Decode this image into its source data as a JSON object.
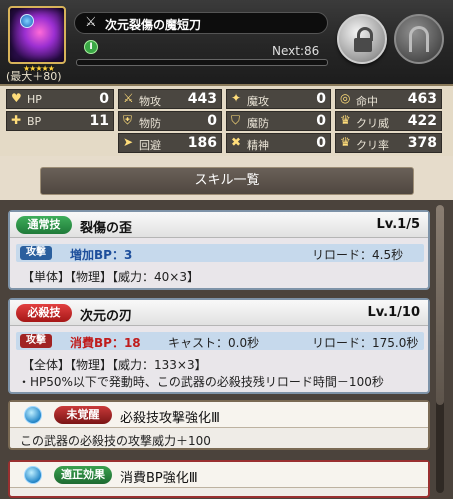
{
  "header": {
    "weapon_name": "次元裂傷の魔短刀",
    "max_label": "(最大＋80)",
    "level_badge": "I",
    "next_label": "Next:86",
    "stars": "★★★★★"
  },
  "stats": [
    {
      "icon": "heart-icon",
      "label": "HP",
      "value": "0"
    },
    {
      "icon": "sword-icon",
      "label": "物攻",
      "value": "443"
    },
    {
      "icon": "magic-icon",
      "label": "魔攻",
      "value": "0"
    },
    {
      "icon": "target-icon",
      "label": "命中",
      "value": "463"
    },
    {
      "icon": "bp-icon",
      "label": "BP",
      "value": "11"
    },
    {
      "icon": "shield-icon",
      "label": "物防",
      "value": "0"
    },
    {
      "icon": "magic-shield-icon",
      "label": "魔防",
      "value": "0"
    },
    {
      "icon": "crit-power-icon",
      "label": "クリ威",
      "value": "422"
    },
    {
      "icon": "evade-icon",
      "label": "回避",
      "value": "186"
    },
    {
      "icon": "spirit-icon",
      "label": "精神",
      "value": "0"
    },
    {
      "icon": "crit-rate-icon",
      "label": "クリ率",
      "value": "378"
    }
  ],
  "skill_tab": "スキル一覧",
  "skills": [
    {
      "type": "通常技",
      "name": "裂傷の歪",
      "level": "Lv.1/5",
      "row_tag": "攻撃",
      "cost": "増加BP：3",
      "cast": "",
      "reload": "リロード：4.5秒",
      "desc_lines": [
        "【単体】【物理】【威力：40×3】"
      ]
    },
    {
      "type": "必殺技",
      "name": "次元の刃",
      "level": "Lv.1/10",
      "row_tag": "攻撃",
      "cost": "消費BP：18",
      "cast": "キャスト：0.0秒",
      "reload": "リロード：175.0秒",
      "desc_lines": [
        "【全体】【物理】【威力：133×3】",
        "・HP50%以下で発動時、この武器の必殺技残リロード時間－100秒"
      ]
    }
  ],
  "unawakened": {
    "badge": "未覚醒",
    "name": "必殺技攻撃強化Ⅲ",
    "desc": "この武器の必殺技の攻撃威力＋100"
  },
  "proper_effect": {
    "badge": "適正効果",
    "name": "消費BP強化Ⅲ"
  }
}
